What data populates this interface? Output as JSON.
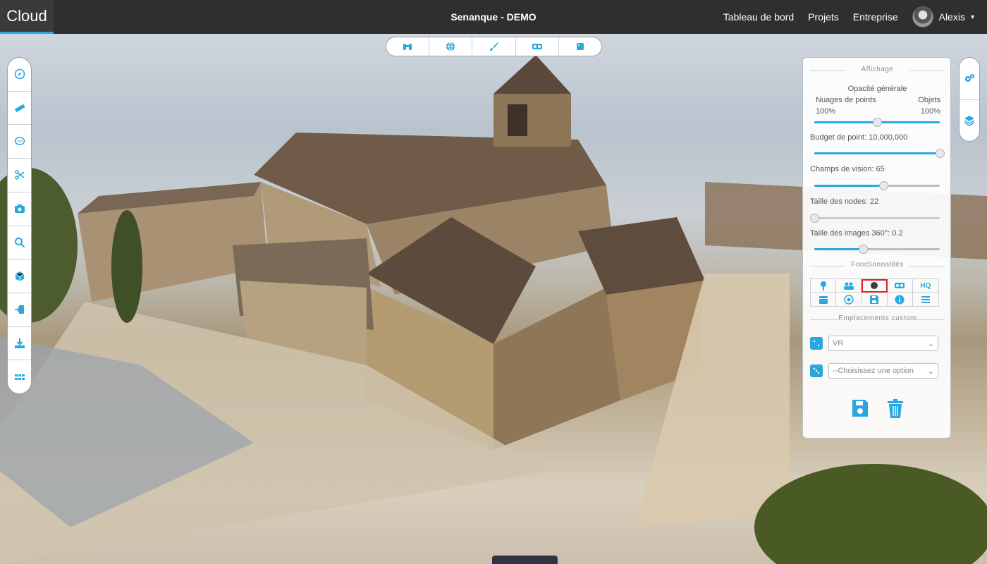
{
  "app": {
    "brand": "Cloud",
    "project_title": "Senanque - DEMO"
  },
  "nav": {
    "items": [
      "Tableau de bord",
      "Projets",
      "Entreprise"
    ],
    "user_name": "Alexis"
  },
  "top_tools": [
    "binoculars-icon",
    "globe-icon",
    "brush-icon",
    "vr-headset-icon",
    "square-icon"
  ],
  "left_tools": [
    "compass-icon",
    "ruler-icon",
    "comment-icon",
    "scissors-icon",
    "camera-icon",
    "search-icon",
    "cube-icon",
    "import-icon",
    "download-icon",
    "grid-icon"
  ],
  "right_tools": [
    "cogs-icon",
    "layers-icon"
  ],
  "panel": {
    "affichage_title": "Affichage",
    "opacity": {
      "label": "Opacité générale",
      "left_label": "Nuages de points",
      "right_label": "Objets",
      "left_value": "100%",
      "right_value": "100%",
      "position": 0.5
    },
    "point_budget": {
      "label": "Budget de point: 10,000,000",
      "level": 1.0
    },
    "fov": {
      "label": "Champs de vision: 65",
      "level": 0.55
    },
    "node_size": {
      "label": "Taille des nodes: 22",
      "level": 0.0
    },
    "image_size": {
      "label": "Taille des images 360°: 0.2",
      "level": 0.39
    },
    "features_title": "Fonctionnalités",
    "features": [
      "marker-icon",
      "users-icon",
      "circle-icon",
      "vr-icon",
      "HQ",
      "calendar-icon",
      "target-icon",
      "save-icon",
      "info-icon",
      "list-icon"
    ],
    "features_active_index": 2,
    "custom_title": "Emplacements custom",
    "custom_select_1": "VR",
    "custom_select_2": "--Choisissez une option"
  },
  "colors": {
    "accent": "#29a8e0",
    "topbar": "#2f2f2f",
    "highlight": "#e0202a"
  }
}
